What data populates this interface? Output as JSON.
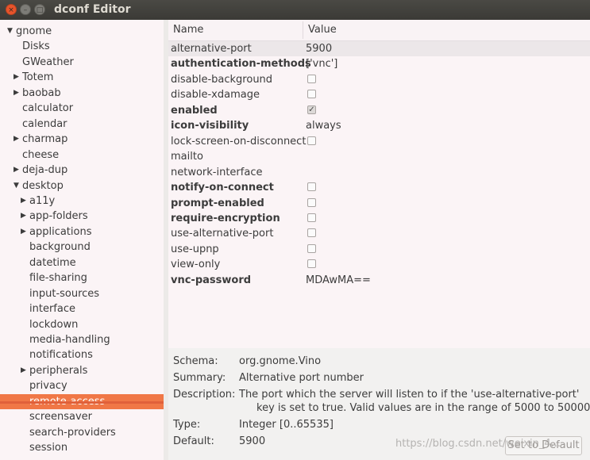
{
  "window": {
    "title": "dconf Editor",
    "controls": {
      "close": "×",
      "minimize": "–",
      "maximize": "□"
    }
  },
  "sidebar": {
    "items": [
      {
        "label": "gnome",
        "expander": "expanded"
      },
      {
        "label": "Disks",
        "expander": "none"
      },
      {
        "label": "GWeather",
        "expander": "none"
      },
      {
        "label": "Totem",
        "expander": "collapsed"
      },
      {
        "label": "baobab",
        "expander": "collapsed"
      },
      {
        "label": "calculator",
        "expander": "none"
      },
      {
        "label": "calendar",
        "expander": "none"
      },
      {
        "label": "charmap",
        "expander": "collapsed"
      },
      {
        "label": "cheese",
        "expander": "none"
      },
      {
        "label": "deja-dup",
        "expander": "collapsed"
      },
      {
        "label": "desktop",
        "expander": "expanded"
      },
      {
        "label": "a11y",
        "expander": "collapsed"
      },
      {
        "label": "app-folders",
        "expander": "collapsed"
      },
      {
        "label": "applications",
        "expander": "collapsed"
      },
      {
        "label": "background",
        "expander": "none"
      },
      {
        "label": "datetime",
        "expander": "none"
      },
      {
        "label": "file-sharing",
        "expander": "none"
      },
      {
        "label": "input-sources",
        "expander": "none"
      },
      {
        "label": "interface",
        "expander": "none"
      },
      {
        "label": "lockdown",
        "expander": "none"
      },
      {
        "label": "media-handling",
        "expander": "none"
      },
      {
        "label": "notifications",
        "expander": "none"
      },
      {
        "label": "peripherals",
        "expander": "collapsed"
      },
      {
        "label": "privacy",
        "expander": "none"
      },
      {
        "label": "remote-access",
        "expander": "none",
        "selected": true
      },
      {
        "label": "screensaver",
        "expander": "none"
      },
      {
        "label": "search-providers",
        "expander": "none"
      },
      {
        "label": "session",
        "expander": "none"
      }
    ]
  },
  "keys_table": {
    "columns": [
      "Name",
      "Value"
    ],
    "rows": [
      {
        "name": "alternative-port",
        "bold": false,
        "value": "5900",
        "selected": true
      },
      {
        "name": "authentication-methods",
        "bold": true,
        "value": "['vnc']"
      },
      {
        "name": "disable-background",
        "bold": false,
        "checkbox": false
      },
      {
        "name": "disable-xdamage",
        "bold": false,
        "checkbox": false
      },
      {
        "name": "enabled",
        "bold": true,
        "checkbox": true
      },
      {
        "name": "icon-visibility",
        "bold": true,
        "value": "always"
      },
      {
        "name": "lock-screen-on-disconnect",
        "bold": false,
        "checkbox": false
      },
      {
        "name": "mailto",
        "bold": false,
        "value": ""
      },
      {
        "name": "network-interface",
        "bold": false,
        "value": ""
      },
      {
        "name": "notify-on-connect",
        "bold": true,
        "checkbox": false
      },
      {
        "name": "prompt-enabled",
        "bold": true,
        "checkbox": false
      },
      {
        "name": "require-encryption",
        "bold": true,
        "checkbox": false
      },
      {
        "name": "use-alternative-port",
        "bold": false,
        "checkbox": false
      },
      {
        "name": "use-upnp",
        "bold": false,
        "checkbox": false
      },
      {
        "name": "view-only",
        "bold": false,
        "checkbox": false
      },
      {
        "name": "vnc-password",
        "bold": true,
        "value": "MDAwMA=="
      }
    ]
  },
  "details": {
    "schema_label": "Schema:",
    "schema_value": "org.gnome.Vino",
    "summary_label": "Summary:",
    "summary_value": "Alternative port number",
    "description_label": "Description:",
    "description_line1": "The port which the server will listen to if the 'use-alternative-port'",
    "description_line2": "key is set to true. Valid values are in the range of 5000 to 50000.",
    "type_label": "Type:",
    "type_value": "Integer [0..65535]",
    "default_label": "Default:",
    "default_value": "5900",
    "reset_button": "Set to Default"
  },
  "watermark": "https://blog.csdn.net/weixin_4...",
  "colors": {
    "selection": "#f07746",
    "titlebar": "#3b3a36",
    "pane_background": "#fbf4f6"
  }
}
